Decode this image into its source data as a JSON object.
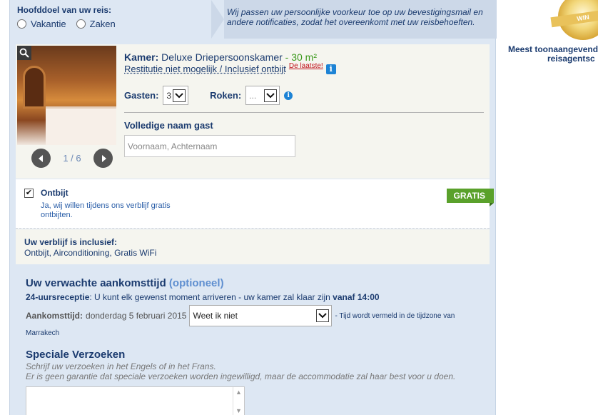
{
  "purpose": {
    "question": "Hoofddoel van uw reis:",
    "options": [
      "Vakantie",
      "Zaken"
    ]
  },
  "note": "Wij passen uw persoonlijke voorkeur toe op uw bevestigingsmail en andere notificaties, zodat het overeenkomt met uw reisbehoeften.",
  "room": {
    "label": "Kamer:",
    "name": "Deluxe Driepersoonskamer",
    "size": "- 30 m²",
    "policy": "Restitutie niet mogelijk / Inclusief ontbijt",
    "last_one": "De laatste!",
    "counter": "1 / 6",
    "guests_label": "Gasten:",
    "guests_value": "3",
    "smoking_label": "Roken:",
    "smoking_value": "...",
    "name_label": "Volledige naam gast",
    "name_placeholder": "Voornaam, Achternaam"
  },
  "breakfast": {
    "title": "Ontbijt",
    "desc": "Ja, wij willen tijdens ons verblijf gratis ontbijten.",
    "badge": "GRATIS",
    "checked": "✔"
  },
  "inclusive": {
    "heading": "Uw verblijf is inclusief:",
    "value": "Ontbijt, Airconditioning, Gratis WiFi"
  },
  "arrival": {
    "heading": "Uw verwachte aankomsttijd",
    "optional": "(optioneel)",
    "reception_bold": "24-uursreceptie",
    "reception_text": ": U kunt elk gewenst moment arriveren - uw kamer zal klaar zijn ",
    "reception_time": "vanaf 14:00",
    "time_label": "Aankomsttijd:",
    "date": "donderdag 5 februari 2015",
    "select_value": "Weet ik niet",
    "tz_note": "- Tijd wordt vermeld in de tijdzone van",
    "tz_city": "Marrakech"
  },
  "special": {
    "heading": "Speciale Verzoeken",
    "line1": "Schrijf uw verzoeken in het Engels of in het Frans.",
    "line2": "Er is geen garantie dat speciale verzoeken worden ingewilligd, maar de accommodatie zal haar best voor u doen."
  },
  "award": {
    "ribbon": "WIN",
    "line1": "Meest toonaangevend",
    "line2": "reisagentsc"
  }
}
